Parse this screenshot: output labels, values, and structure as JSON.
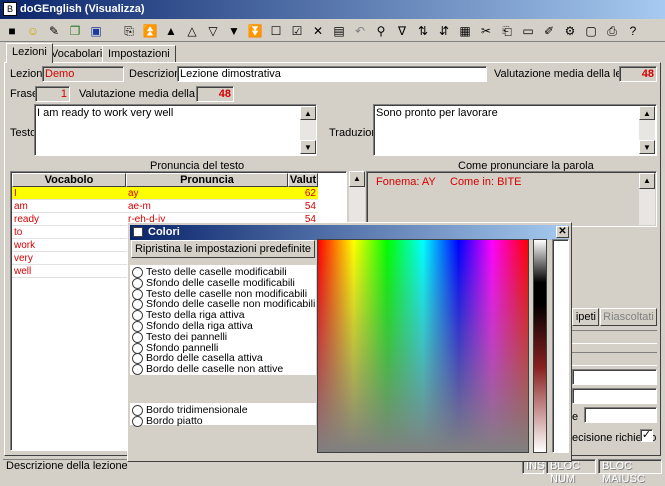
{
  "app": {
    "title": "doGEnglish (Visualizza)"
  },
  "tabs": [
    "Lezioni",
    "Vocabolario",
    "Impostazioni"
  ],
  "lesson": {
    "label": "Lezione",
    "value": "Demo",
    "desc_label": "Descrizione",
    "desc_value": "Lezione dimostrativa",
    "avg_label": "Valutazione media della lezione",
    "avg_value": "48"
  },
  "sentence": {
    "label": "Frase",
    "value": "1",
    "avg_label": "Valutazione media della frase",
    "avg_value": "48"
  },
  "text": {
    "label": "Testo",
    "value": "I am ready to work very well"
  },
  "translation": {
    "label": "Traduzione",
    "value": "Sono pronto per lavorare"
  },
  "pronunciation": {
    "caption": "Pronuncia del testo",
    "headers": [
      "Vocabolo",
      "Pronuncia",
      "Valut"
    ],
    "rows": [
      {
        "word": "I",
        "pron": "ay",
        "score": "62"
      },
      {
        "word": "am",
        "pron": "ae-m",
        "score": "54"
      },
      {
        "word": "ready",
        "pron": "r-eh-d-iy",
        "score": "54"
      },
      {
        "word": "to",
        "pron": "",
        "score": ""
      },
      {
        "word": "work",
        "pron": "",
        "score": ""
      },
      {
        "word": "very",
        "pron": "",
        "score": ""
      },
      {
        "word": "well",
        "pron": "",
        "score": ""
      }
    ]
  },
  "howto": {
    "caption": "Come pronunciare la parola",
    "phoneme_label": "Fonema: AY",
    "example_label": "Come in: BITE"
  },
  "side_buttons": {
    "repeat": "ipeti",
    "listen": "Riascoltati"
  },
  "side_labels": {
    "partial_e": "e",
    "precision": "ecisione richiesto"
  },
  "dialog": {
    "title": "Colori",
    "reset_button": "Ripristina le impostazioni predefinite",
    "options": [
      "Testo delle caselle modificabili",
      "Sfondo delle caselle modificabili",
      "Testo delle caselle non modificabili",
      "Sfondo delle caselle non modificabili",
      "Testo della riga attiva",
      "Sfondo della riga attiva",
      "Testo dei pannelli",
      "Sfondo pannelli",
      "Bordo delle casella attiva",
      "Bordo delle caselle non attive"
    ],
    "border_options": [
      "Bordo tridimensionale",
      "Bordo piatto"
    ]
  },
  "status": {
    "hint": "Descrizione della lezione",
    "ins": "INS",
    "num": "BLOC NUM",
    "caps": "BLOC MAIUSC"
  }
}
